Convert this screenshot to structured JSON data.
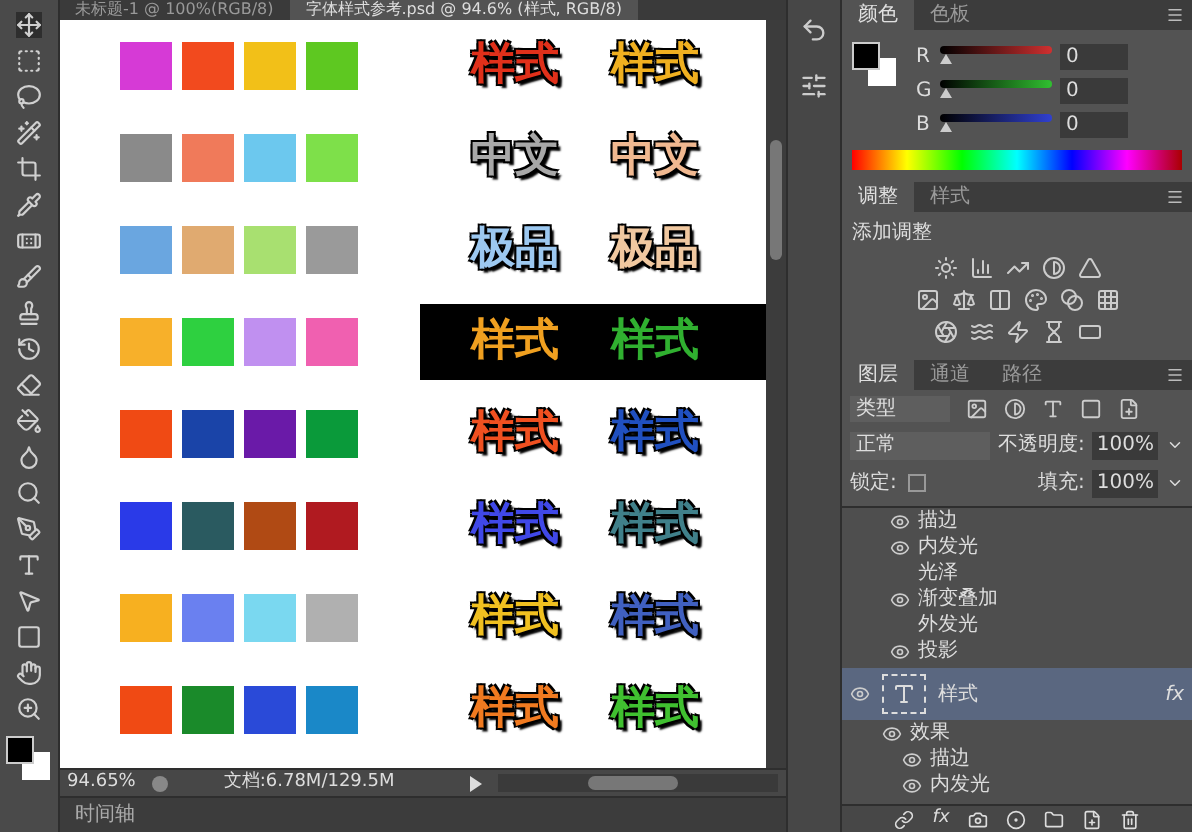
{
  "document_tabs": [
    {
      "label": "未标题-1 @ 100%(RGB/8)",
      "selected": false
    },
    {
      "label": "字体样式参考.psd @ 94.6% (样式, RGB/8)",
      "selected": true
    }
  ],
  "canvas": {
    "rows": [
      {
        "dark_band": false,
        "swatches": [
          {
            "color": "#d63ad6"
          },
          {
            "color": "#f24a1e"
          },
          {
            "color": "#f2c018"
          },
          {
            "color": "#5ec821"
          }
        ],
        "labels": [
          {
            "text": "样式",
            "color": "#e0301a"
          },
          {
            "text": "样式",
            "color": "#f0b020"
          }
        ]
      },
      {
        "dark_band": false,
        "swatches": [
          {
            "color": "#8a8a8a"
          },
          {
            "color": "#f07a5a"
          },
          {
            "color": "#6cc8ee"
          },
          {
            "color": "#7ee04a"
          }
        ],
        "labels": [
          {
            "text": "中文",
            "color": "#a8a8a8"
          },
          {
            "text": "中文",
            "color": "#f0b890"
          }
        ]
      },
      {
        "dark_band": false,
        "swatches": [
          {
            "color": "#6aa6e0"
          },
          {
            "color": "#e0aa70"
          },
          {
            "color": "#a8e070"
          },
          {
            "color": "#9a9a9a"
          }
        ],
        "labels": [
          {
            "text": "极品",
            "color": "#9cc8f0"
          },
          {
            "text": "极品",
            "color": "#f0c8a0"
          }
        ]
      },
      {
        "dark_band": true,
        "swatches": [
          {
            "color": "#f7b02a"
          },
          {
            "color": "#2ed040"
          },
          {
            "color": "#c090f0"
          },
          {
            "color": "#f060b0"
          }
        ],
        "labels": [
          {
            "text": "样式",
            "color": "#f0a020"
          },
          {
            "text": "样式",
            "color": "#30b030"
          }
        ]
      },
      {
        "dark_band": false,
        "swatches": [
          {
            "color": "#f04a14"
          },
          {
            "color": "#1a44a8"
          },
          {
            "color": "#6a1aa8"
          },
          {
            "color": "#0a9a3a"
          }
        ],
        "labels": [
          {
            "text": "样式",
            "color": "#f05020"
          },
          {
            "text": "样式",
            "color": "#2050c0"
          }
        ]
      },
      {
        "dark_band": false,
        "swatches": [
          {
            "color": "#2a3ae8"
          },
          {
            "color": "#2a5a60"
          },
          {
            "color": "#b04a14"
          },
          {
            "color": "#b01a20"
          }
        ],
        "labels": [
          {
            "text": "样式",
            "color": "#4048e8"
          },
          {
            "text": "样式",
            "color": "#40808a"
          }
        ]
      },
      {
        "dark_band": false,
        "swatches": [
          {
            "color": "#f7b020"
          },
          {
            "color": "#6a80f0"
          },
          {
            "color": "#7ad8f0"
          },
          {
            "color": "#b0b0b0"
          }
        ],
        "labels": [
          {
            "text": "样式",
            "color": "#f0c020"
          },
          {
            "text": "样式",
            "color": "#4060c0"
          }
        ]
      },
      {
        "dark_band": false,
        "swatches": [
          {
            "color": "#f04a14"
          },
          {
            "color": "#1a8a2a"
          },
          {
            "color": "#2a4ad8"
          },
          {
            "color": "#1a88c8"
          }
        ],
        "labels": [
          {
            "text": "样式",
            "color": "#f07a20"
          },
          {
            "text": "样式",
            "color": "#40c030"
          }
        ]
      }
    ]
  },
  "status_bar": {
    "zoom": "94.65%",
    "document": "文档:6.78M/129.5M"
  },
  "timeline": {
    "title": "时间轴"
  },
  "color_panel": {
    "tabs": [
      {
        "label": "颜色",
        "selected": true
      },
      {
        "label": "色板",
        "selected": false
      }
    ],
    "channels": [
      {
        "name": "R",
        "value": "0",
        "level": 0
      },
      {
        "name": "G",
        "value": "0",
        "level": 0
      },
      {
        "name": "B",
        "value": "0",
        "level": 0
      }
    ]
  },
  "adjustments_panel": {
    "tabs": [
      {
        "label": "调整",
        "selected": true
      },
      {
        "label": "样式",
        "selected": false
      }
    ],
    "title": "添加调整"
  },
  "layers_panel": {
    "tabs": [
      {
        "label": "图层",
        "selected": true
      },
      {
        "label": "通道",
        "selected": false
      },
      {
        "label": "路径",
        "selected": false
      }
    ],
    "filter": "类型",
    "blend_mode": "正常",
    "opacity_label": "不透明度:",
    "opacity": "100%",
    "lock_label": "锁定:",
    "fill_label": "填充:",
    "fill": "100%",
    "effects": [
      {
        "name": "描边",
        "visible": true
      },
      {
        "name": "内发光",
        "visible": true
      },
      {
        "name": "光泽",
        "visible": false
      },
      {
        "name": "渐变叠加",
        "visible": true
      },
      {
        "name": "外发光",
        "visible": false
      },
      {
        "name": "投影",
        "visible": true
      }
    ],
    "layer": {
      "name": "样式",
      "fx": "fx",
      "selected": true,
      "visible": true
    },
    "layer_effects": [
      {
        "name": "效果",
        "visible": true
      },
      {
        "name": "描边",
        "visible": true
      },
      {
        "name": "内发光",
        "visible": true
      }
    ],
    "bottom_fx": "fx"
  }
}
